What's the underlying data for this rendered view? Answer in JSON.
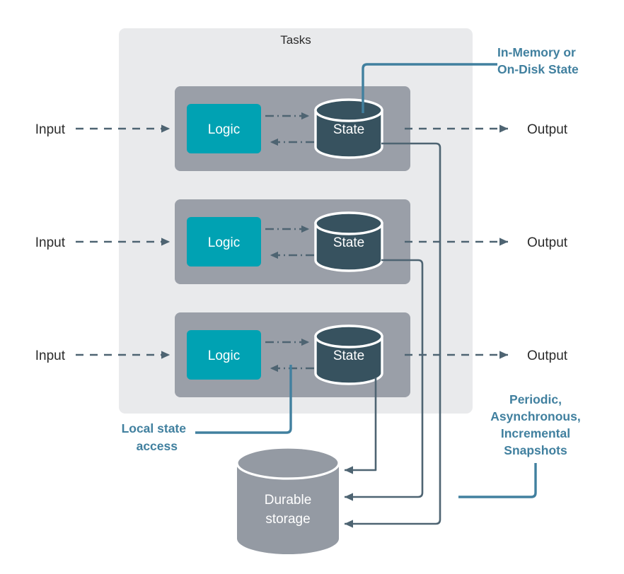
{
  "diagram": {
    "title_label": "Tasks",
    "colors": {
      "background": "#ffffff",
      "tasks_panel": "#e9eaec",
      "task_row": "#9a9fa8",
      "logic_fill": "#00a2b3",
      "state_fill": "#37525f",
      "state_stroke": "#ffffff",
      "storage_fill": "#949aa3",
      "connector": "#4e6472",
      "annotation": "#41809f",
      "text_dark": "#2b2b2b",
      "text_light": "#ffffff"
    }
  },
  "tasks": {
    "panel_label": "Tasks",
    "rows": [
      {
        "input_label": "Input",
        "logic_label": "Logic",
        "state_label": "State",
        "output_label": "Output"
      },
      {
        "input_label": "Input",
        "logic_label": "Logic",
        "state_label": "State",
        "output_label": "Output"
      },
      {
        "input_label": "Input",
        "logic_label": "Logic",
        "state_label": "State",
        "output_label": "Output"
      }
    ]
  },
  "storage": {
    "label_line1": "Durable",
    "label_line2": "storage"
  },
  "annotations": {
    "in_memory": {
      "line1": "In-Memory or",
      "line2": "On-Disk State"
    },
    "local_access": {
      "line1": "Local state",
      "line2": "access"
    },
    "snapshots": {
      "line1": "Periodic,",
      "line2": "Asynchronous,",
      "line3": "Incremental",
      "line4": "Snapshots"
    }
  }
}
